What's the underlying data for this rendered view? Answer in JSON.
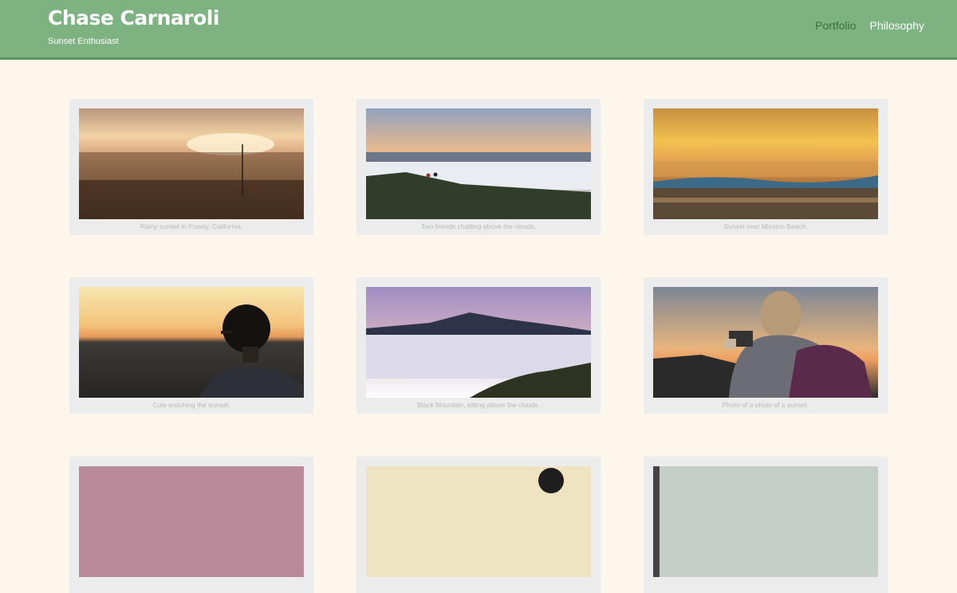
{
  "header": {
    "title": "Chase Carnaroli",
    "tagline": "Sunset Enthusiast",
    "background_color": "#7db380"
  },
  "nav": {
    "items": [
      {
        "label": "Portfolio",
        "color": "#3f6a42"
      },
      {
        "label": "Philosophy",
        "color": "#ffffff"
      }
    ]
  },
  "gallery": {
    "items": [
      {
        "caption": "Rainy sunset in Poway, California."
      },
      {
        "caption": "Two friends chatting above the clouds."
      },
      {
        "caption": "Sunset over Mission Beach."
      },
      {
        "caption": "Cole watching the sunset."
      },
      {
        "caption": "Black Mountain, sitting above the clouds."
      },
      {
        "caption": "Photo of a photo of a sunset."
      },
      {
        "caption": ""
      },
      {
        "caption": ""
      },
      {
        "caption": ""
      }
    ]
  },
  "colors": {
    "page_background": "#fdf6eb",
    "card_background": "#ececec",
    "caption_text": "#b8b8b8"
  }
}
